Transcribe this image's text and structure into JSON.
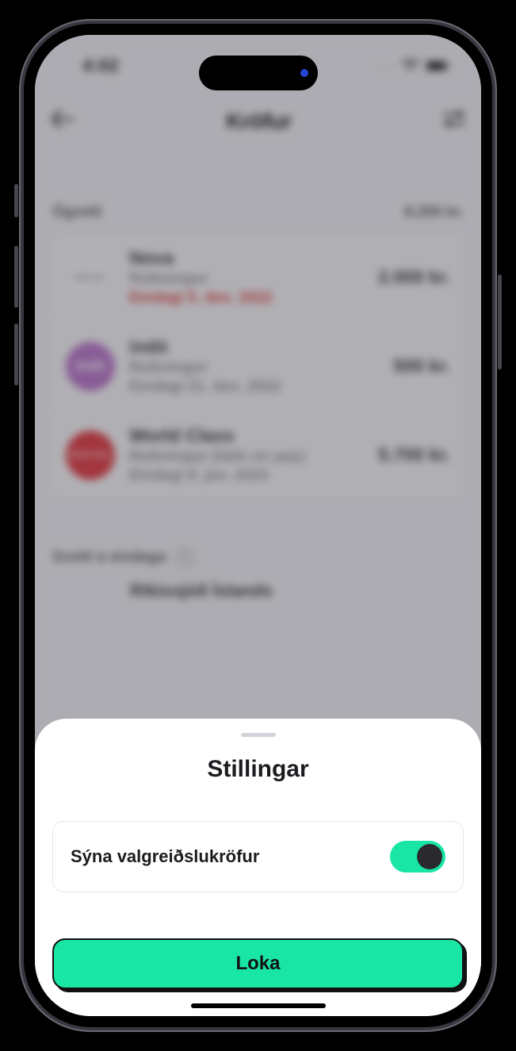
{
  "status": {
    "time": "4:02",
    "cellular": "....",
    "wifi": "wifi",
    "battery": "full"
  },
  "header": {
    "title": "Kröfur"
  },
  "section_unpaid": {
    "label": "Ógreitt",
    "total": "8.200 kr."
  },
  "items": [
    {
      "name": "Nova",
      "subtitle": "Reikningur",
      "due": "Eindagi 5. des. 2022",
      "overdue": true,
      "amount": "2.000 kr.",
      "avatar_text": "NOVA",
      "avatar_class": "nova"
    },
    {
      "name": "indó",
      "subtitle": "Reikningur",
      "due": "Eindagi 21. des. 2022",
      "overdue": false,
      "amount": "500 kr.",
      "avatar_text": "indó",
      "avatar_class": "indo"
    },
    {
      "name": "World Class",
      "subtitle": "Reikningur (fails on pay)",
      "due": "Eindagi 8. jan. 2023",
      "overdue": false,
      "amount": "5.700 kr.",
      "avatar_text": "World Class",
      "avatar_class": "worldclass"
    }
  ],
  "section_paid": {
    "label": "Greitt á eindaga",
    "help": "?"
  },
  "peek": {
    "text": "Ríkissjóð Íslands"
  },
  "sheet": {
    "title": "Stillingar",
    "toggle_label": "Sýna valgreiðslukröfur",
    "toggle_on": true,
    "close_label": "Loka"
  }
}
